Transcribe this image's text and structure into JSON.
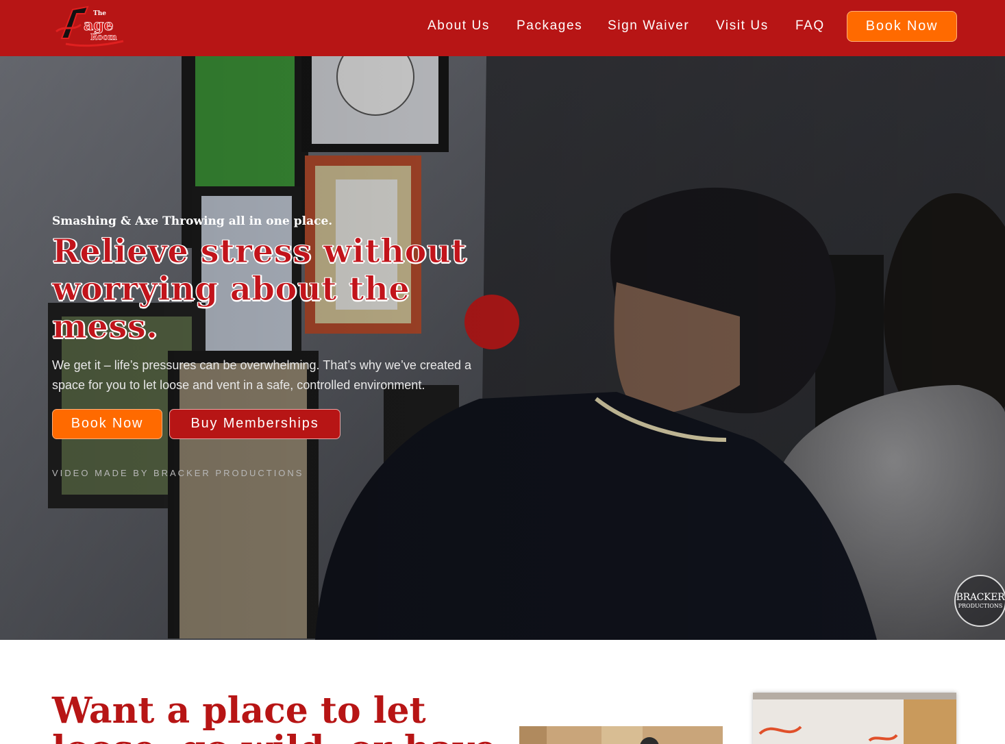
{
  "header": {
    "logo_text": "The Rage Room",
    "nav": {
      "about": "About Us",
      "packages": "Packages",
      "waiver": "Sign Waiver",
      "visit": "Visit Us",
      "faq": "FAQ",
      "book": "Book Now"
    }
  },
  "hero": {
    "tagline": "Smashing & Axe Throwing all in one place.",
    "headline_lines": [
      "Relieve stress without",
      "worrying about the",
      "mess."
    ],
    "description": "We get it – life’s pressures can be overwhelming. That’s why we’ve created a space for you to let loose and vent in a safe, controlled environment.",
    "book_button": "Book Now",
    "membership_button": "Buy Memberships",
    "credit": "VIDEO MADE BY BRACKER PRODUCTIONS",
    "watermark_line1": "BRACKER",
    "watermark_line2": "PRODUCTIONS"
  },
  "intro": {
    "title_lines": [
      "Want a place to let",
      "loose, go wild, or have"
    ]
  },
  "colors": {
    "brand_red": "#b71515",
    "accent_orange": "#ff6a00",
    "headline_red": "#c2141b"
  }
}
